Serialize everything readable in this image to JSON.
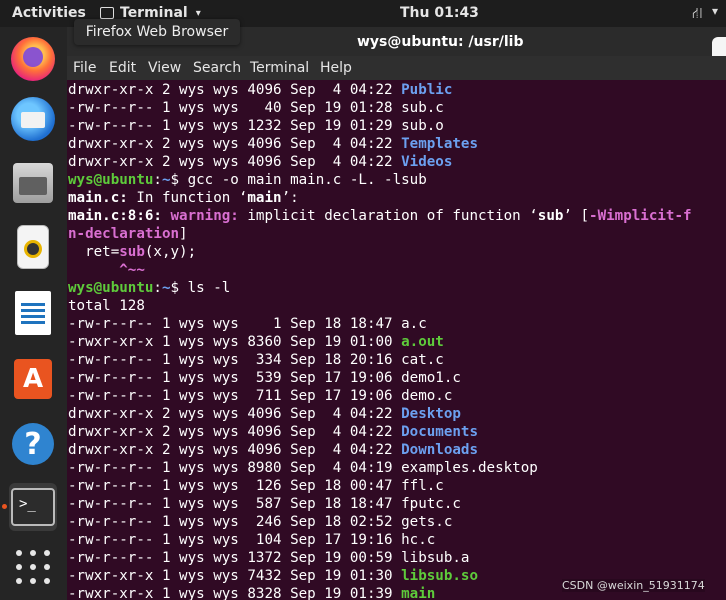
{
  "topbar": {
    "activities": "Activities",
    "app_menu": "Terminal",
    "clock": "Thu 01:43"
  },
  "tooltip": "Firefox Web Browser",
  "window": {
    "title": "wys@ubuntu: /usr/lib",
    "menu": [
      "File",
      "Edit",
      "View",
      "Search",
      "Terminal",
      "Help"
    ]
  },
  "dock": {
    "apps": [
      "firefox-icon",
      "thunderbird-icon",
      "files-icon",
      "rhythmbox-icon",
      "libreoffice-writer-icon",
      "software-center-icon",
      "help-icon",
      "terminal-icon"
    ],
    "show_apps": "show-applications-icon"
  },
  "colors": {
    "terminal_bg": "#300a24",
    "directory": "#6ca0f0",
    "executable": "#5ecb3b",
    "warning": "#d96fd1",
    "ubuntu_orange": "#e95420"
  },
  "terminal": {
    "lines": [
      [
        {
          "t": "drwxr-xr-x 2 wys wys 4096 Sep  4 04:22 "
        },
        {
          "t": "Public",
          "c": "dir"
        }
      ],
      [
        {
          "t": "-rw-r--r-- 1 wys wys   40 Sep 19 01:28 sub.c"
        }
      ],
      [
        {
          "t": "-rw-r--r-- 1 wys wys 1232 Sep 19 01:29 sub.o"
        }
      ],
      [
        {
          "t": "drwxr-xr-x 2 wys wys 4096 Sep  4 04:22 "
        },
        {
          "t": "Templates",
          "c": "dir"
        }
      ],
      [
        {
          "t": "drwxr-xr-x 2 wys wys 4096 Sep  4 04:22 "
        },
        {
          "t": "Videos",
          "c": "dir"
        }
      ],
      [
        {
          "t": "wys@ubuntu",
          "c": "prompt"
        },
        {
          "t": ":"
        },
        {
          "t": "~",
          "c": "path"
        },
        {
          "t": "$ gcc -o main main.c -L. -lsub"
        }
      ],
      [
        {
          "t": "main.c:",
          "c": "bold"
        },
        {
          "t": " In function ‘"
        },
        {
          "t": "main",
          "c": "bold"
        },
        {
          "t": "’:"
        }
      ],
      [
        {
          "t": "main.c:8:6: ",
          "c": "bold"
        },
        {
          "t": "warning: ",
          "c": "warn"
        },
        {
          "t": "implicit declaration of function ‘"
        },
        {
          "t": "sub",
          "c": "bold"
        },
        {
          "t": "’ ["
        },
        {
          "t": "-Wimplicit-f",
          "c": "warn"
        }
      ],
      [
        {
          "t": "n-declaration",
          "c": "warn"
        },
        {
          "t": "]"
        }
      ],
      [
        {
          "t": "  ret="
        },
        {
          "t": "sub",
          "c": "warn"
        },
        {
          "t": "(x,y);"
        }
      ],
      [
        {
          "t": "      ^~~",
          "c": "warn"
        }
      ],
      [
        {
          "t": "wys@ubuntu",
          "c": "prompt"
        },
        {
          "t": ":"
        },
        {
          "t": "~",
          "c": "path"
        },
        {
          "t": "$ ls -l"
        }
      ],
      [
        {
          "t": "total 128"
        }
      ],
      [
        {
          "t": "-rw-r--r-- 1 wys wys    1 Sep 18 18:47 a.c"
        }
      ],
      [
        {
          "t": "-rwxr-xr-x 1 wys wys 8360 Sep 19 01:00 "
        },
        {
          "t": "a.out",
          "c": "exe"
        }
      ],
      [
        {
          "t": "-rw-r--r-- 1 wys wys  334 Sep 18 20:16 cat.c"
        }
      ],
      [
        {
          "t": "-rw-r--r-- 1 wys wys  539 Sep 17 19:06 demo1.c"
        }
      ],
      [
        {
          "t": "-rw-r--r-- 1 wys wys  711 Sep 17 19:06 demo.c"
        }
      ],
      [
        {
          "t": "drwxr-xr-x 2 wys wys 4096 Sep  4 04:22 "
        },
        {
          "t": "Desktop",
          "c": "dir"
        }
      ],
      [
        {
          "t": "drwxr-xr-x 2 wys wys 4096 Sep  4 04:22 "
        },
        {
          "t": "Documents",
          "c": "dir"
        }
      ],
      [
        {
          "t": "drwxr-xr-x 2 wys wys 4096 Sep  4 04:22 "
        },
        {
          "t": "Downloads",
          "c": "dir"
        }
      ],
      [
        {
          "t": "-rw-r--r-- 1 wys wys 8980 Sep  4 04:19 examples.desktop"
        }
      ],
      [
        {
          "t": "-rw-r--r-- 1 wys wys  126 Sep 18 00:47 ffl.c"
        }
      ],
      [
        {
          "t": "-rw-r--r-- 1 wys wys  587 Sep 18 18:47 fputc.c"
        }
      ],
      [
        {
          "t": "-rw-r--r-- 1 wys wys  246 Sep 18 02:52 gets.c"
        }
      ],
      [
        {
          "t": "-rw-r--r-- 1 wys wys  104 Sep 17 19:16 hc.c"
        }
      ],
      [
        {
          "t": "-rw-r--r-- 1 wys wys 1372 Sep 19 00:59 libsub.a"
        }
      ],
      [
        {
          "t": "-rwxr-xr-x 1 wys wys 7432 Sep 19 01:30 "
        },
        {
          "t": "libsub.so",
          "c": "exe"
        }
      ],
      [
        {
          "t": "-rwxr-xr-x 1 wys wys 8328 Sep 19 01:39 "
        },
        {
          "t": "main",
          "c": "exe"
        }
      ]
    ]
  },
  "watermark": "CSDN @weixin_51931174"
}
